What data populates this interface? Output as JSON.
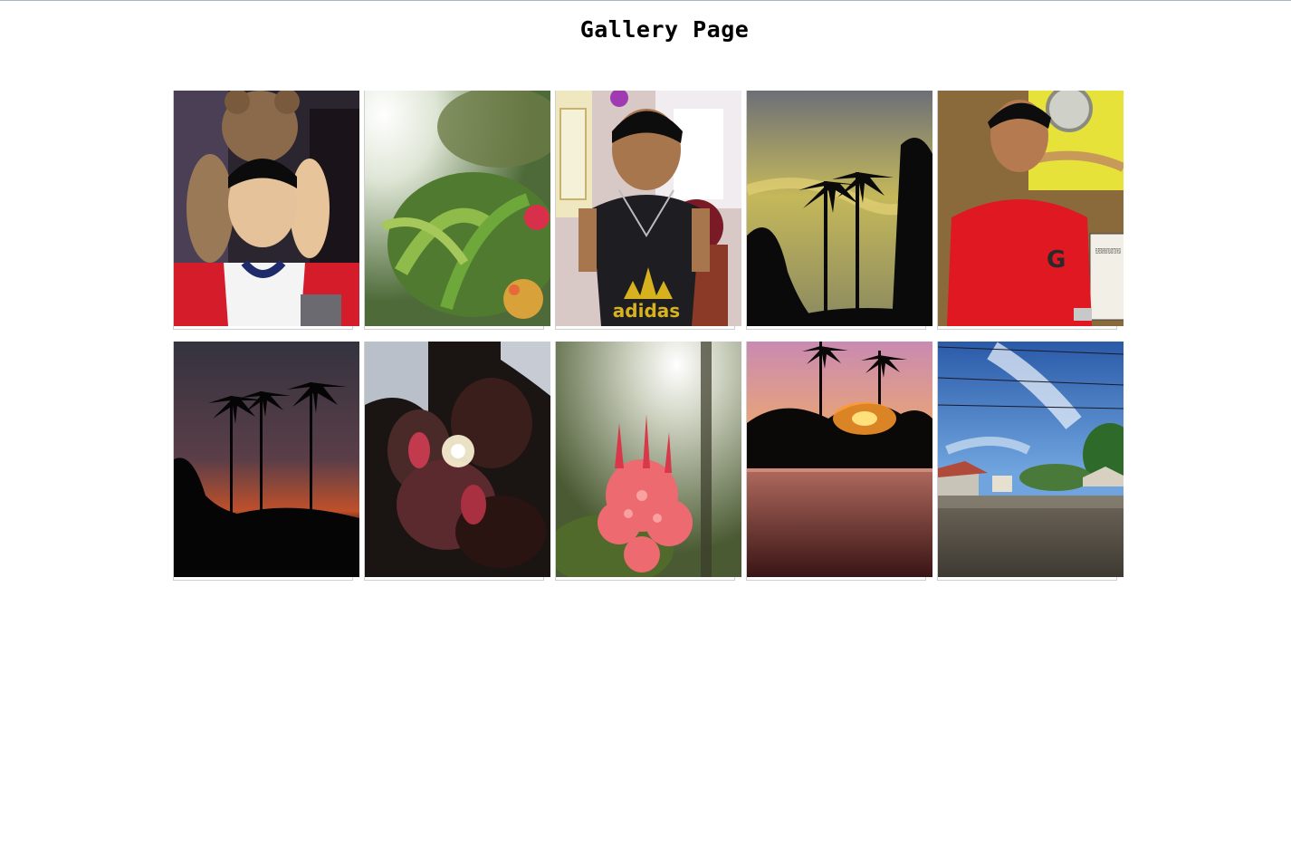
{
  "page": {
    "title": "Gallery Page"
  },
  "gallery": {
    "items": [
      {
        "subject": "boy-with-teddy-bear"
      },
      {
        "subject": "sunlit-plant"
      },
      {
        "subject": "boy-in-adidas-shirt",
        "shirt_text": "adidas"
      },
      {
        "subject": "palm-trees-yellow-sky"
      },
      {
        "subject": "boy-in-red-shirt",
        "shirt_text": "G",
        "sign_text": "FEEL FREE TAKE PHO BUT PLEA DON'T TOU THE CAR"
      },
      {
        "subject": "palm-silhouette-sunset"
      },
      {
        "subject": "sun-through-leaves"
      },
      {
        "subject": "red-ixora-flower"
      },
      {
        "subject": "sunset-over-wall"
      },
      {
        "subject": "blue-sky-rooftops"
      }
    ]
  }
}
